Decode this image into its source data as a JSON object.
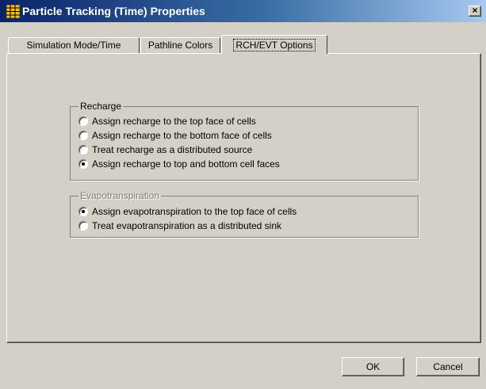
{
  "window": {
    "title": "Particle Tracking (Time) Properties",
    "close_glyph": "×",
    "icon": "app-grid-icon"
  },
  "tabs": [
    {
      "label": "Simulation Mode/Time",
      "active": false
    },
    {
      "label": "Pathline Colors",
      "active": false
    },
    {
      "label": "RCH/EVT Options",
      "active": true
    }
  ],
  "recharge": {
    "legend": "Recharge",
    "options": [
      {
        "label": "Assign recharge to the top face of cells",
        "checked": false
      },
      {
        "label": "Assign recharge to the bottom face of cells",
        "checked": false
      },
      {
        "label": "Treat recharge as a distributed source",
        "checked": false
      },
      {
        "label": "Assign recharge to top and bottom cell faces",
        "checked": true
      }
    ]
  },
  "evapotranspiration": {
    "legend": "Evapotranspiration",
    "enabled": false,
    "options": [
      {
        "label": "Assign evapotranspiration to the top face of cells",
        "checked": true
      },
      {
        "label": "Treat evapotranspiration as a distributed sink",
        "checked": false
      }
    ]
  },
  "buttons": {
    "ok": "OK",
    "cancel": "Cancel"
  },
  "colors": {
    "title_start": "#0a246a",
    "title_end": "#a6caf0",
    "face": "#d4d0c8"
  }
}
